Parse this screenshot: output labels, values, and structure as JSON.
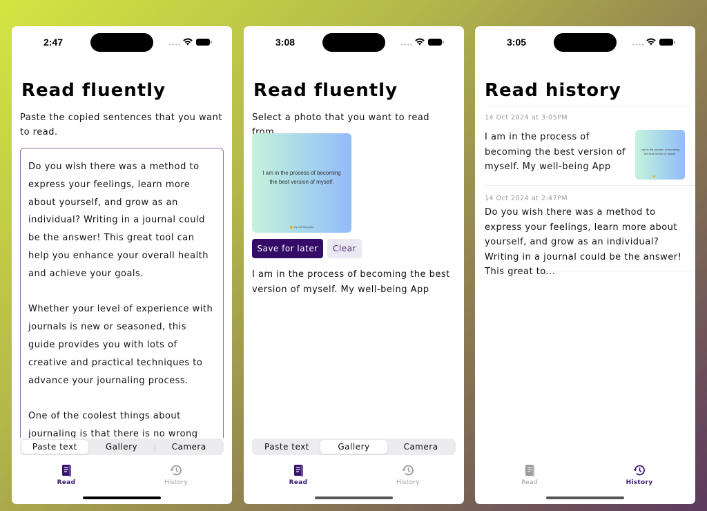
{
  "colors": {
    "accent": "#340c67",
    "accent_light": "#ece8f2",
    "textarea_border": "#8b6aa8",
    "inactive_tab": "#9a9a9a"
  },
  "screens": [
    {
      "status": {
        "time": "2:47"
      },
      "title": "Read fluently",
      "instruction": "Paste the copied sentences that you want to read.",
      "textarea_value": "Do you wish there was a method to express your feelings, learn more about yourself, and grow as an individual? Writing in a journal could be the answer! This great tool can help you enhance your overall health and achieve your goals.\n\nWhether your level of experience with journals is new or seasoned, this guide provides you with lots of creative and practical techniques to advance your journaling process.\n\nOne of the coolest things about journaling is that there is no wrong way to do",
      "segments": [
        "Paste text",
        "Gallery",
        "Camera"
      ],
      "active_segment": "Paste text",
      "tabs": [
        {
          "label": "Read",
          "icon": "book-icon",
          "active": true
        },
        {
          "label": "History",
          "icon": "history-icon",
          "active": false
        }
      ]
    },
    {
      "status": {
        "time": "3:08"
      },
      "title": "Read fluently",
      "instruction": "Select a photo that you want to read from.",
      "photo": {
        "text": "I am in the process of becoming the best version of myself.",
        "footer": "My well-being App"
      },
      "buttons": {
        "save": "Save for later",
        "clear": "Clear"
      },
      "recognized_text": "I am in the process of becoming the best version of myself. My well-being App",
      "segments": [
        "Paste text",
        "Gallery",
        "Camera"
      ],
      "active_segment": "Gallery",
      "tabs": [
        {
          "label": "Read",
          "icon": "book-icon",
          "active": true
        },
        {
          "label": "History",
          "icon": "history-icon",
          "active": false
        }
      ]
    },
    {
      "status": {
        "time": "3:05"
      },
      "title": "Read history",
      "history": [
        {
          "date": "14 Oct 2024 at 3:05PM",
          "text": "I am in the process of becoming the best version of myself. My well-being App",
          "thumbnail_text": "I am in the process of becoming the best version of myself."
        },
        {
          "date": "14 Oct 2024 at 2:47PM",
          "text": "Do you wish there was a method to express your feelings, learn more about yourself, and grow as an individual? Writing in a journal could be the answer! This great to..."
        }
      ],
      "tabs": [
        {
          "label": "Read",
          "icon": "book-icon",
          "active": false
        },
        {
          "label": "History",
          "icon": "history-icon",
          "active": true
        }
      ]
    }
  ]
}
